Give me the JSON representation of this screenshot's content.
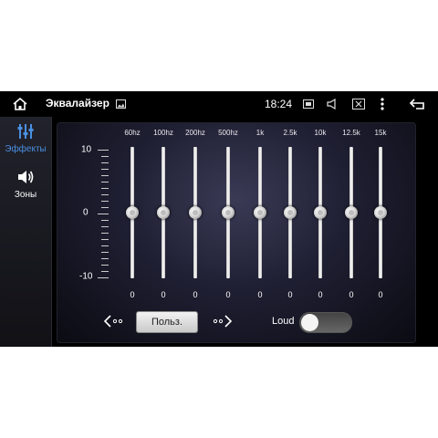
{
  "statusbar": {
    "title": "Эквалайзер",
    "time": "18:24"
  },
  "sidebar": {
    "items": [
      {
        "label": "Эффекты",
        "icon": "equalizer-icon",
        "active": true
      },
      {
        "label": "Зоны",
        "icon": "speaker-icon",
        "active": false
      }
    ]
  },
  "equalizer": {
    "scale": {
      "top": "10",
      "mid": "0",
      "bottom": "-10"
    },
    "bands": [
      {
        "freq": "60hz",
        "value": "0"
      },
      {
        "freq": "100hz",
        "value": "0"
      },
      {
        "freq": "200hz",
        "value": "0"
      },
      {
        "freq": "500hz",
        "value": "0"
      },
      {
        "freq": "1k",
        "value": "0"
      },
      {
        "freq": "2.5k",
        "value": "0"
      },
      {
        "freq": "10k",
        "value": "0"
      },
      {
        "freq": "12.5k",
        "value": "0"
      },
      {
        "freq": "15k",
        "value": "0"
      }
    ]
  },
  "controls": {
    "preset_label": "Польз.",
    "loud_label": "Loud",
    "loud_on": false
  },
  "colors": {
    "accent": "#4a8fe0",
    "background": "#000000"
  }
}
